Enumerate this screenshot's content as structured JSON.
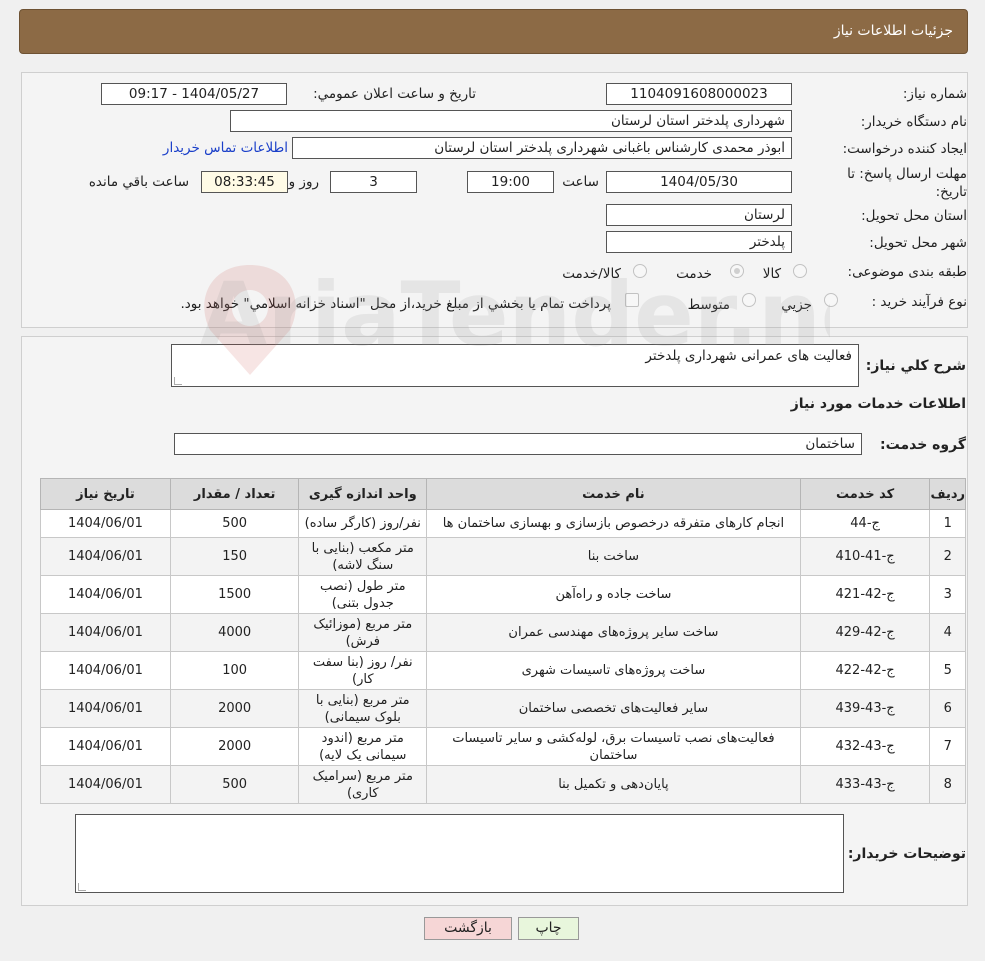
{
  "header": {
    "title": "جزئیات اطلاعات نیاز"
  },
  "form": {
    "need_number_label": "شماره نیاز:",
    "need_number": "1104091608000023",
    "announce_label": "تاریخ و ساعت اعلان عمومي:",
    "announce_value": "1404/05/27 - 09:17",
    "buyer_org_label": "نام دستگاه خريدار:",
    "buyer_org": "شهرداری پلدختر استان لرستان",
    "requester_label": "ايجاد کننده درخواست:",
    "requester": "ابوذر محمدی کارشناس باغبانی شهرداری پلدختر استان لرستان",
    "contact_link": "اطلاعات تماس خريدار",
    "deadline_label_1": "مهلت ارسال پاسخ: تا",
    "deadline_label_2": "تاريخ:",
    "deadline_date": "1404/05/30",
    "time_label": "ساعت",
    "deadline_time": "19:00",
    "days": "3",
    "days_label": "روز و",
    "remaining_time": "08:33:45",
    "remaining_label": "ساعت باقي مانده",
    "province_label": "استان محل تحويل:",
    "province": "لرستان",
    "city_label": "شهر محل تحويل:",
    "city": "پلدختر",
    "category_label": "طبقه بندی موضوعی:",
    "category_options": [
      "کالا",
      "خدمت",
      "کالا/خدمت"
    ],
    "category_selected": "خدمت",
    "purchase_type_label": "نوع فرآیند خرید :",
    "purchase_options": [
      "جزيي",
      "متوسط"
    ],
    "purchase_note": "پرداخت تمام يا بخشي از مبلغ خريد،از محل \"اسناد خزانه اسلامي\" خواهد بود."
  },
  "details": {
    "summary_label": "شرح کلي نياز:",
    "summary": "فعالیت های عمرانی شهرداری پلدختر",
    "services_title": "اطلاعات خدمات مورد نياز",
    "service_group_label": "گروه خدمت:",
    "service_group": "ساختمان",
    "table": {
      "headers": [
        "رديف",
        "کد خدمت",
        "نام خدمت",
        "واحد اندازه گيری",
        "تعداد / مقدار",
        "تاريخ نياز"
      ],
      "rows": [
        [
          "1",
          "ج-44",
          "انجام کارهای متفرقه درخصوص بازسازی و بهسازی ساختمان ها",
          "نفر/روز (کارگر ساده)",
          "500",
          "1404/06/01"
        ],
        [
          "2",
          "ج-41-410",
          "ساخت بنا",
          "متر مکعب (بنایی با سنگ لاشه)",
          "150",
          "1404/06/01"
        ],
        [
          "3",
          "ج-42-421",
          "ساخت جاده و راه‌آهن",
          "متر طول (نصب جدول بتنی)",
          "1500",
          "1404/06/01"
        ],
        [
          "4",
          "ج-42-429",
          "ساخت سایر پروژه‌های مهندسی عمران",
          "متر مربع (موزائیک فرش)",
          "4000",
          "1404/06/01"
        ],
        [
          "5",
          "ج-42-422",
          "ساخت پروژه‌های تاسیسات شهری",
          "نفر/ روز (بنا سفت کار)",
          "100",
          "1404/06/01"
        ],
        [
          "6",
          "ج-43-439",
          "سایر فعالیت‌های تخصصی ساختمان",
          "متر مربع (بنایی با بلوک سیمانی)",
          "2000",
          "1404/06/01"
        ],
        [
          "7",
          "ج-43-432",
          "فعالیت‌های نصب تاسیسات برق، لوله‌کشی و سایر تاسیسات ساختمان",
          "متر مربع (اندود سیمانی یک لایه)",
          "2000",
          "1404/06/01"
        ],
        [
          "8",
          "ج-43-433",
          "پایان‌دهی و تکمیل بنا",
          "متر مربع (سرامیک کاری)",
          "500",
          "1404/06/01"
        ]
      ]
    },
    "buyer_notes_label": "توضيحات خريدار:",
    "buyer_notes": ""
  },
  "buttons": {
    "print": "چاپ",
    "back": "بازگشت"
  },
  "watermark": {
    "text": "AriaTender.neT"
  },
  "colors": {
    "header_bg": "#8c6a45",
    "link": "#1a3fc9",
    "back_btn": "#f6d6d6",
    "print_btn": "#e8f6dc"
  }
}
